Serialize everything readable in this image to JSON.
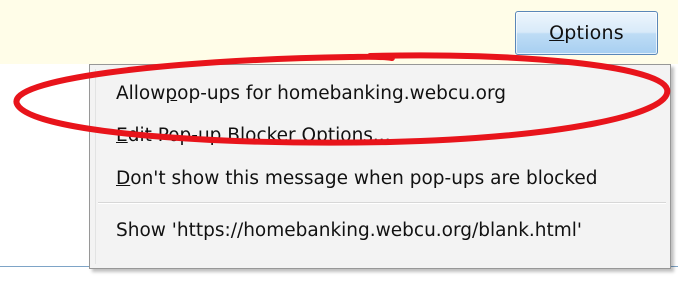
{
  "notification_bar": {
    "options_button": {
      "prefix": "",
      "accel": "O",
      "rest": "ptions"
    }
  },
  "menu": {
    "items": [
      {
        "pre": "Allow ",
        "accel": "p",
        "post": "op-ups for homebanking.webcu.org"
      },
      {
        "pre": "",
        "accel": "E",
        "post": "dit Pop-up Blocker Options..."
      },
      {
        "pre": "",
        "accel": "D",
        "post": "on't show this message when pop-ups are blocked"
      },
      {
        "pre": "Show 'https://homebanking.webcu.org/blank.html'",
        "accel": "",
        "post": ""
      }
    ]
  },
  "annotation": {
    "ellipse_color": "#e8141b"
  }
}
